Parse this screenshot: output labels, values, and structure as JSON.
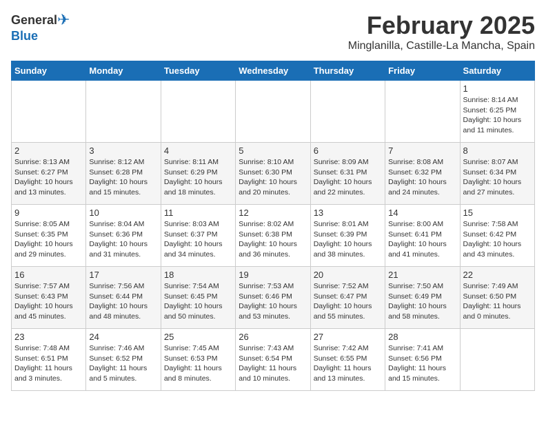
{
  "header": {
    "logo_general": "General",
    "logo_blue": "Blue",
    "month_title": "February 2025",
    "location": "Minglanilla, Castille-La Mancha, Spain"
  },
  "days_of_week": [
    "Sunday",
    "Monday",
    "Tuesday",
    "Wednesday",
    "Thursday",
    "Friday",
    "Saturday"
  ],
  "weeks": [
    [
      {
        "day": "",
        "info": ""
      },
      {
        "day": "",
        "info": ""
      },
      {
        "day": "",
        "info": ""
      },
      {
        "day": "",
        "info": ""
      },
      {
        "day": "",
        "info": ""
      },
      {
        "day": "",
        "info": ""
      },
      {
        "day": "1",
        "info": "Sunrise: 8:14 AM\nSunset: 6:25 PM\nDaylight: 10 hours and 11 minutes."
      }
    ],
    [
      {
        "day": "2",
        "info": "Sunrise: 8:13 AM\nSunset: 6:27 PM\nDaylight: 10 hours and 13 minutes."
      },
      {
        "day": "3",
        "info": "Sunrise: 8:12 AM\nSunset: 6:28 PM\nDaylight: 10 hours and 15 minutes."
      },
      {
        "day": "4",
        "info": "Sunrise: 8:11 AM\nSunset: 6:29 PM\nDaylight: 10 hours and 18 minutes."
      },
      {
        "day": "5",
        "info": "Sunrise: 8:10 AM\nSunset: 6:30 PM\nDaylight: 10 hours and 20 minutes."
      },
      {
        "day": "6",
        "info": "Sunrise: 8:09 AM\nSunset: 6:31 PM\nDaylight: 10 hours and 22 minutes."
      },
      {
        "day": "7",
        "info": "Sunrise: 8:08 AM\nSunset: 6:32 PM\nDaylight: 10 hours and 24 minutes."
      },
      {
        "day": "8",
        "info": "Sunrise: 8:07 AM\nSunset: 6:34 PM\nDaylight: 10 hours and 27 minutes."
      }
    ],
    [
      {
        "day": "9",
        "info": "Sunrise: 8:05 AM\nSunset: 6:35 PM\nDaylight: 10 hours and 29 minutes."
      },
      {
        "day": "10",
        "info": "Sunrise: 8:04 AM\nSunset: 6:36 PM\nDaylight: 10 hours and 31 minutes."
      },
      {
        "day": "11",
        "info": "Sunrise: 8:03 AM\nSunset: 6:37 PM\nDaylight: 10 hours and 34 minutes."
      },
      {
        "day": "12",
        "info": "Sunrise: 8:02 AM\nSunset: 6:38 PM\nDaylight: 10 hours and 36 minutes."
      },
      {
        "day": "13",
        "info": "Sunrise: 8:01 AM\nSunset: 6:39 PM\nDaylight: 10 hours and 38 minutes."
      },
      {
        "day": "14",
        "info": "Sunrise: 8:00 AM\nSunset: 6:41 PM\nDaylight: 10 hours and 41 minutes."
      },
      {
        "day": "15",
        "info": "Sunrise: 7:58 AM\nSunset: 6:42 PM\nDaylight: 10 hours and 43 minutes."
      }
    ],
    [
      {
        "day": "16",
        "info": "Sunrise: 7:57 AM\nSunset: 6:43 PM\nDaylight: 10 hours and 45 minutes."
      },
      {
        "day": "17",
        "info": "Sunrise: 7:56 AM\nSunset: 6:44 PM\nDaylight: 10 hours and 48 minutes."
      },
      {
        "day": "18",
        "info": "Sunrise: 7:54 AM\nSunset: 6:45 PM\nDaylight: 10 hours and 50 minutes."
      },
      {
        "day": "19",
        "info": "Sunrise: 7:53 AM\nSunset: 6:46 PM\nDaylight: 10 hours and 53 minutes."
      },
      {
        "day": "20",
        "info": "Sunrise: 7:52 AM\nSunset: 6:47 PM\nDaylight: 10 hours and 55 minutes."
      },
      {
        "day": "21",
        "info": "Sunrise: 7:50 AM\nSunset: 6:49 PM\nDaylight: 10 hours and 58 minutes."
      },
      {
        "day": "22",
        "info": "Sunrise: 7:49 AM\nSunset: 6:50 PM\nDaylight: 11 hours and 0 minutes."
      }
    ],
    [
      {
        "day": "23",
        "info": "Sunrise: 7:48 AM\nSunset: 6:51 PM\nDaylight: 11 hours and 3 minutes."
      },
      {
        "day": "24",
        "info": "Sunrise: 7:46 AM\nSunset: 6:52 PM\nDaylight: 11 hours and 5 minutes."
      },
      {
        "day": "25",
        "info": "Sunrise: 7:45 AM\nSunset: 6:53 PM\nDaylight: 11 hours and 8 minutes."
      },
      {
        "day": "26",
        "info": "Sunrise: 7:43 AM\nSunset: 6:54 PM\nDaylight: 11 hours and 10 minutes."
      },
      {
        "day": "27",
        "info": "Sunrise: 7:42 AM\nSunset: 6:55 PM\nDaylight: 11 hours and 13 minutes."
      },
      {
        "day": "28",
        "info": "Sunrise: 7:41 AM\nSunset: 6:56 PM\nDaylight: 11 hours and 15 minutes."
      },
      {
        "day": "",
        "info": ""
      }
    ]
  ]
}
